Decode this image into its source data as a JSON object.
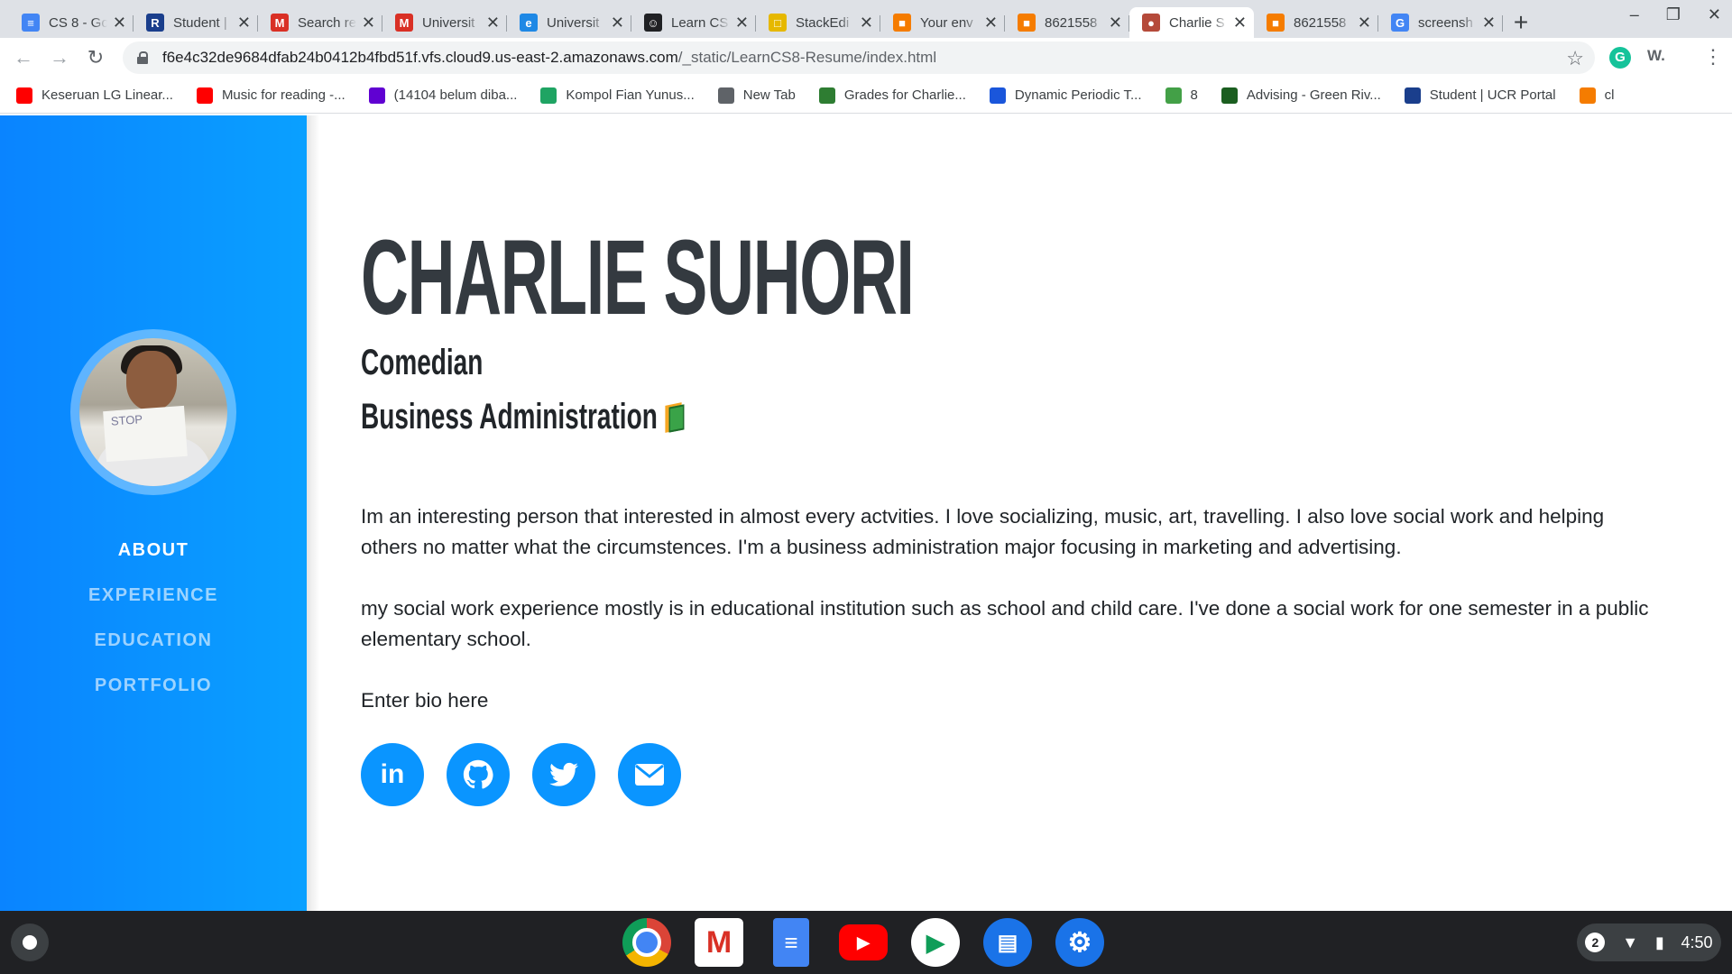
{
  "tabs": [
    {
      "title": "CS 8 - Go",
      "icon": "google-docs-icon",
      "color": "#4285f4",
      "glyph": "≡"
    },
    {
      "title": "Student |",
      "icon": "r-icon",
      "color": "#1a3e8c",
      "glyph": "R"
    },
    {
      "title": "Search re",
      "icon": "gmail-icon",
      "color": "#d93025",
      "glyph": "M"
    },
    {
      "title": "Universit",
      "icon": "gmail-icon",
      "color": "#d93025",
      "glyph": "M"
    },
    {
      "title": "Universit",
      "icon": "globe-icon",
      "color": "#1e88e5",
      "glyph": "e"
    },
    {
      "title": "Learn CS",
      "icon": "learn-icon",
      "color": "#202124",
      "glyph": "☺"
    },
    {
      "title": "StackEdi",
      "icon": "stackedit-icon",
      "color": "#e6b800",
      "glyph": "□"
    },
    {
      "title": "Your env",
      "icon": "cube-icon",
      "color": "#f57c00",
      "glyph": "■"
    },
    {
      "title": "8621558",
      "icon": "cube-icon",
      "color": "#f57c00",
      "glyph": "■"
    },
    {
      "title": "Charlie S",
      "icon": "profile-favicon-icon",
      "color": "#b54a3a",
      "glyph": "●",
      "active": true
    },
    {
      "title": "8621558",
      "icon": "cube-icon",
      "color": "#f57c00",
      "glyph": "■"
    },
    {
      "title": "screensh",
      "icon": "google-icon",
      "color": "#4285f4",
      "glyph": "G"
    }
  ],
  "omnibox": {
    "url_host": "f6e4c32de9684dfab24b0412b4fbd51f.vfs.cloud9.us-east-2.amazonaws.com",
    "url_path": "/_static/LearnCS8-Resume/index.html"
  },
  "bookmarks": [
    {
      "label": "Keseruan LG Linear...",
      "icon": "youtube-icon",
      "color": "#ff0000"
    },
    {
      "label": "Music for reading -...",
      "icon": "youtube-icon",
      "color": "#ff0000"
    },
    {
      "label": "(14104 belum diba...",
      "icon": "mail-icon",
      "color": "#6001d2"
    },
    {
      "label": "Kompol Fian Yunus...",
      "icon": "drive-icon",
      "color": "#1fa463"
    },
    {
      "label": "New Tab",
      "icon": "globe-icon",
      "color": "#5f6368"
    },
    {
      "label": "Grades for Charlie...",
      "icon": "grades-icon",
      "color": "#2e7d32"
    },
    {
      "label": "Dynamic Periodic T...",
      "icon": "pt-icon",
      "color": "#1a56db"
    },
    {
      "label": "8",
      "icon": "triangle-icon",
      "color": "#43a047"
    },
    {
      "label": "Advising - Green Riv...",
      "icon": "advising-icon",
      "color": "#1b5e20"
    },
    {
      "label": "Student | UCR Portal",
      "icon": "r-icon",
      "color": "#1a3e8c"
    },
    {
      "label": "cl",
      "icon": "cube-icon",
      "color": "#f57c00"
    }
  ],
  "sidebar": {
    "nav": [
      {
        "label": "ABOUT",
        "active": true
      },
      {
        "label": "EXPERIENCE"
      },
      {
        "label": "EDUCATION"
      },
      {
        "label": "PORTFOLIO"
      }
    ],
    "photo_sign_text": "STOP"
  },
  "main": {
    "name": "CHARLIE SUHORI",
    "subtitle1": "Comedian",
    "subtitle2": "Business Administration",
    "bio": [
      "Im an interesting person that interested in almost every actvities. I love socializing, music, art, travelling. I also love social work and helping others no matter what the circumstences. I'm a business administration major focusing in marketing and advertising.",
      "my social work experience mostly is in educational institution such as school and child care. I've done a social work for one semester in a public elementary school.",
      "Enter bio here"
    ],
    "social": [
      {
        "label": "in",
        "icon": "linkedin-icon"
      },
      {
        "label": "",
        "icon": "github-icon"
      },
      {
        "label": "",
        "icon": "twitter-icon"
      },
      {
        "label": "",
        "icon": "email-icon"
      }
    ]
  },
  "shelf": {
    "notification_count": "2",
    "time": "4:50"
  },
  "colors": {
    "sidebar_start": "#0a84ff",
    "sidebar_end": "#0aa0ff",
    "accent": "#0a95ff",
    "heading": "#343a40"
  }
}
